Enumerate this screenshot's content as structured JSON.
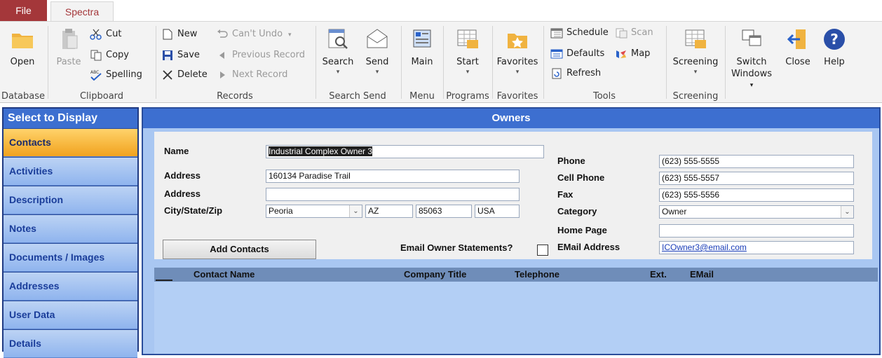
{
  "tabs": {
    "file": "File",
    "spectra": "Spectra"
  },
  "ribbon": {
    "database": {
      "open": "Open",
      "label": "Database"
    },
    "clipboard": {
      "paste": "Paste",
      "cut": "Cut",
      "copy": "Copy",
      "spelling": "Spelling",
      "label": "Clipboard"
    },
    "records": {
      "new": "New",
      "save": "Save",
      "delete": "Delete",
      "cant_undo": "Can't Undo",
      "previous": "Previous Record",
      "next": "Next Record",
      "label": "Records"
    },
    "search_send": {
      "search": "Search",
      "send": "Send",
      "label": "Search Send"
    },
    "menu": {
      "main": "Main",
      "label": "Menu"
    },
    "programs": {
      "start": "Start",
      "label": "Programs"
    },
    "favorites": {
      "favorites": "Favorites",
      "label": "Favorites"
    },
    "tools": {
      "schedule": "Schedule",
      "scan": "Scan",
      "defaults": "Defaults",
      "map": "Map",
      "refresh": "Refresh",
      "label": "Tools"
    },
    "screening": {
      "screening": "Screening",
      "label": "Screening"
    },
    "window": {
      "switch": "Switch",
      "windows": "Windows",
      "close": "Close",
      "help": "Help"
    }
  },
  "left": {
    "title": "Select to Display",
    "items": [
      "Contacts",
      "Activities",
      "Description",
      "Notes",
      "Documents / Images",
      "Addresses",
      "User Data",
      "Details"
    ]
  },
  "main": {
    "title": "Owners",
    "labels": {
      "name": "Name",
      "address1": "Address",
      "address2": "Address",
      "city_state_zip": "City/State/Zip",
      "phone": "Phone",
      "cell": "Cell Phone",
      "fax": "Fax",
      "category": "Category",
      "home_page": "Home Page",
      "email": "EMail Address",
      "email_statements": "Email Owner Statements?"
    },
    "values": {
      "name": "Industrial Complex Owner 3",
      "address1": "160134 Paradise Trail",
      "address2": "",
      "city": "Peoria",
      "state": "AZ",
      "zip": "85063",
      "country": "USA",
      "phone": "(623) 555-5555",
      "cell": "(623) 555-5557",
      "fax": "(623) 555-5556",
      "category": "Owner",
      "home_page": "",
      "email": "ICOwner3@email.com"
    },
    "add_contacts": "Add Contacts",
    "grid_headers": [
      "Contact Name",
      "Company Title",
      "Telephone",
      "Ext.",
      "EMail"
    ]
  }
}
